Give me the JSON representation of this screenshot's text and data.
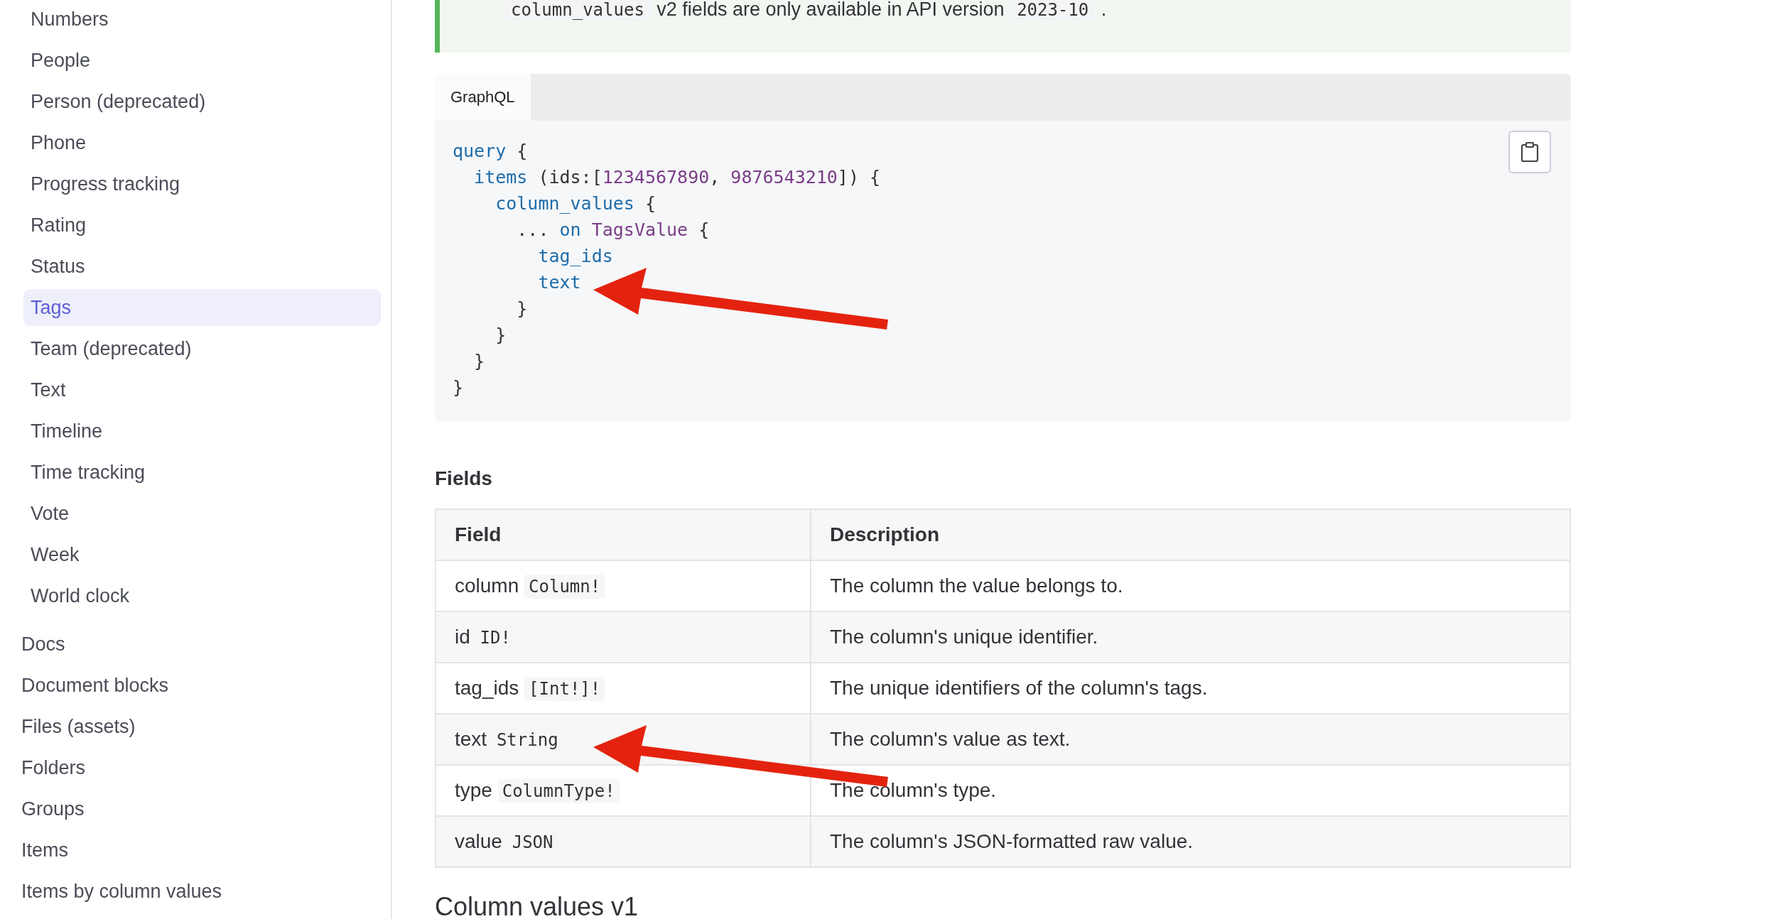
{
  "sidebar": {
    "sub_items": [
      {
        "label": "Numbers",
        "selected": false
      },
      {
        "label": "People",
        "selected": false
      },
      {
        "label": "Person (deprecated)",
        "selected": false
      },
      {
        "label": "Phone",
        "selected": false
      },
      {
        "label": "Progress tracking",
        "selected": false
      },
      {
        "label": "Rating",
        "selected": false
      },
      {
        "label": "Status",
        "selected": false
      },
      {
        "label": "Tags",
        "selected": true
      },
      {
        "label": "Team (deprecated)",
        "selected": false
      },
      {
        "label": "Text",
        "selected": false
      },
      {
        "label": "Timeline",
        "selected": false
      },
      {
        "label": "Time tracking",
        "selected": false
      },
      {
        "label": "Vote",
        "selected": false
      },
      {
        "label": "Week",
        "selected": false
      },
      {
        "label": "World clock",
        "selected": false
      }
    ],
    "items": [
      {
        "label": "Docs",
        "selected": false
      },
      {
        "label": "Document blocks",
        "selected": false
      },
      {
        "label": "Files (assets)",
        "selected": false
      },
      {
        "label": "Folders",
        "selected": false
      },
      {
        "label": "Groups",
        "selected": false
      },
      {
        "label": "Items",
        "selected": false
      },
      {
        "label": "Items by column values",
        "selected": false
      }
    ]
  },
  "note": {
    "parts": [
      {
        "kind": "code",
        "text": "column_values"
      },
      {
        "kind": "text",
        "text": " v2 fields are only available in API version "
      },
      {
        "kind": "code",
        "text": "2023-10"
      },
      {
        "kind": "text",
        "text": " ."
      }
    ]
  },
  "code_block": {
    "tabs": [
      {
        "label": "GraphQL",
        "selected": true
      }
    ],
    "lines": [
      [
        {
          "kind": "keyword",
          "text": "query"
        },
        {
          "kind": "plain",
          "text": " {"
        }
      ],
      [
        {
          "kind": "keyword",
          "text": "  items"
        },
        {
          "kind": "plain",
          "text": " (ids:["
        },
        {
          "kind": "number",
          "text": "1234567890"
        },
        {
          "kind": "plain",
          "text": ", "
        },
        {
          "kind": "number",
          "text": "9876543210"
        },
        {
          "kind": "plain",
          "text": "]) {"
        }
      ],
      [
        {
          "kind": "keyword",
          "text": "    column_values"
        },
        {
          "kind": "plain",
          "text": " {"
        }
      ],
      [
        {
          "kind": "plain",
          "text": "      ... "
        },
        {
          "kind": "keyword",
          "text": "on"
        },
        {
          "kind": "number",
          "text": " TagsValue"
        },
        {
          "kind": "plain",
          "text": " {"
        }
      ],
      [
        {
          "kind": "keyword",
          "text": "        tag_ids"
        }
      ],
      [
        {
          "kind": "keyword",
          "text": "        text"
        }
      ],
      [
        {
          "kind": "plain",
          "text": "      }"
        }
      ],
      [
        {
          "kind": "plain",
          "text": "    }"
        }
      ],
      [
        {
          "kind": "plain",
          "text": "  }"
        }
      ],
      [
        {
          "kind": "plain",
          "text": "}"
        }
      ]
    ]
  },
  "fields_heading": "Fields",
  "table": {
    "columns": [
      "Field",
      "Description"
    ],
    "rows": [
      {
        "name": "column",
        "type": "Column!",
        "description": "The column the value belongs to."
      },
      {
        "name": "id",
        "type": "ID!",
        "description": "The column's unique identifier."
      },
      {
        "name": "tag_ids",
        "type": "[Int!]!",
        "description": "The unique identifiers of the column's tags."
      },
      {
        "name": "text",
        "type": "String",
        "description": "The column's value as text."
      },
      {
        "name": "type",
        "type": "ColumnType!",
        "description": "The column's type."
      },
      {
        "name": "value",
        "type": "JSON",
        "description": "The column's JSON-formatted raw value."
      }
    ]
  },
  "next_heading": "Column values v1"
}
